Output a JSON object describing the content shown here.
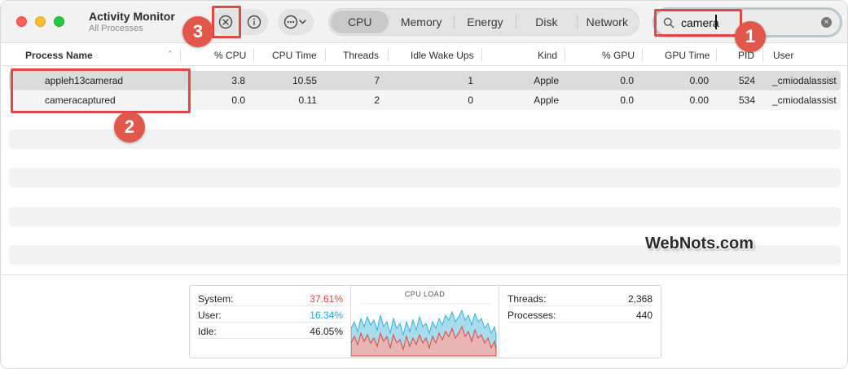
{
  "window": {
    "app_title": "Activity Monitor",
    "subtitle": "All Processes"
  },
  "toolbar": {
    "stop_icon": "stop-process-icon",
    "info_icon": "info-icon",
    "more_icon": "more-options-icon",
    "tabs": [
      {
        "label": "CPU",
        "active": true
      },
      {
        "label": "Memory",
        "active": false
      },
      {
        "label": "Energy",
        "active": false
      },
      {
        "label": "Disk",
        "active": false
      },
      {
        "label": "Network",
        "active": false
      }
    ]
  },
  "search": {
    "value": "camera",
    "icon": "search-icon",
    "clear_icon": "clear-icon"
  },
  "table": {
    "columns": [
      "Process Name",
      "% CPU",
      "CPU Time",
      "Threads",
      "Idle Wake Ups",
      "Kind",
      "% GPU",
      "GPU Time",
      "PID",
      "User"
    ],
    "rows": [
      {
        "name": "appleh13camerad",
        "cpu": "3.8",
        "cpu_time": "10.55",
        "threads": "7",
        "idle_wake_ups": "1",
        "kind": "Apple",
        "gpu": "0.0",
        "gpu_time": "0.00",
        "pid": "524",
        "user": "_cmiodalassist"
      },
      {
        "name": "cameracaptured",
        "cpu": "0.0",
        "cpu_time": "0.11",
        "threads": "2",
        "idle_wake_ups": "0",
        "kind": "Apple",
        "gpu": "0.0",
        "gpu_time": "0.00",
        "pid": "534",
        "user": "_cmiodalassist"
      }
    ]
  },
  "annotations": {
    "badge_1": "1",
    "badge_2": "2",
    "badge_3": "3",
    "highlight_color": "#e04848"
  },
  "footer": {
    "system_label": "System:",
    "system_value": "37.61%",
    "system_color": "#e0443e",
    "user_label": "User:",
    "user_value": "16.34%",
    "user_color": "#1ea7d6",
    "idle_label": "Idle:",
    "idle_value": "46.05%",
    "cpu_load_title": "CPU LOAD",
    "threads_label": "Threads:",
    "threads_value": "2,368",
    "processes_label": "Processes:",
    "processes_value": "440"
  },
  "watermark": "WebNots.com"
}
